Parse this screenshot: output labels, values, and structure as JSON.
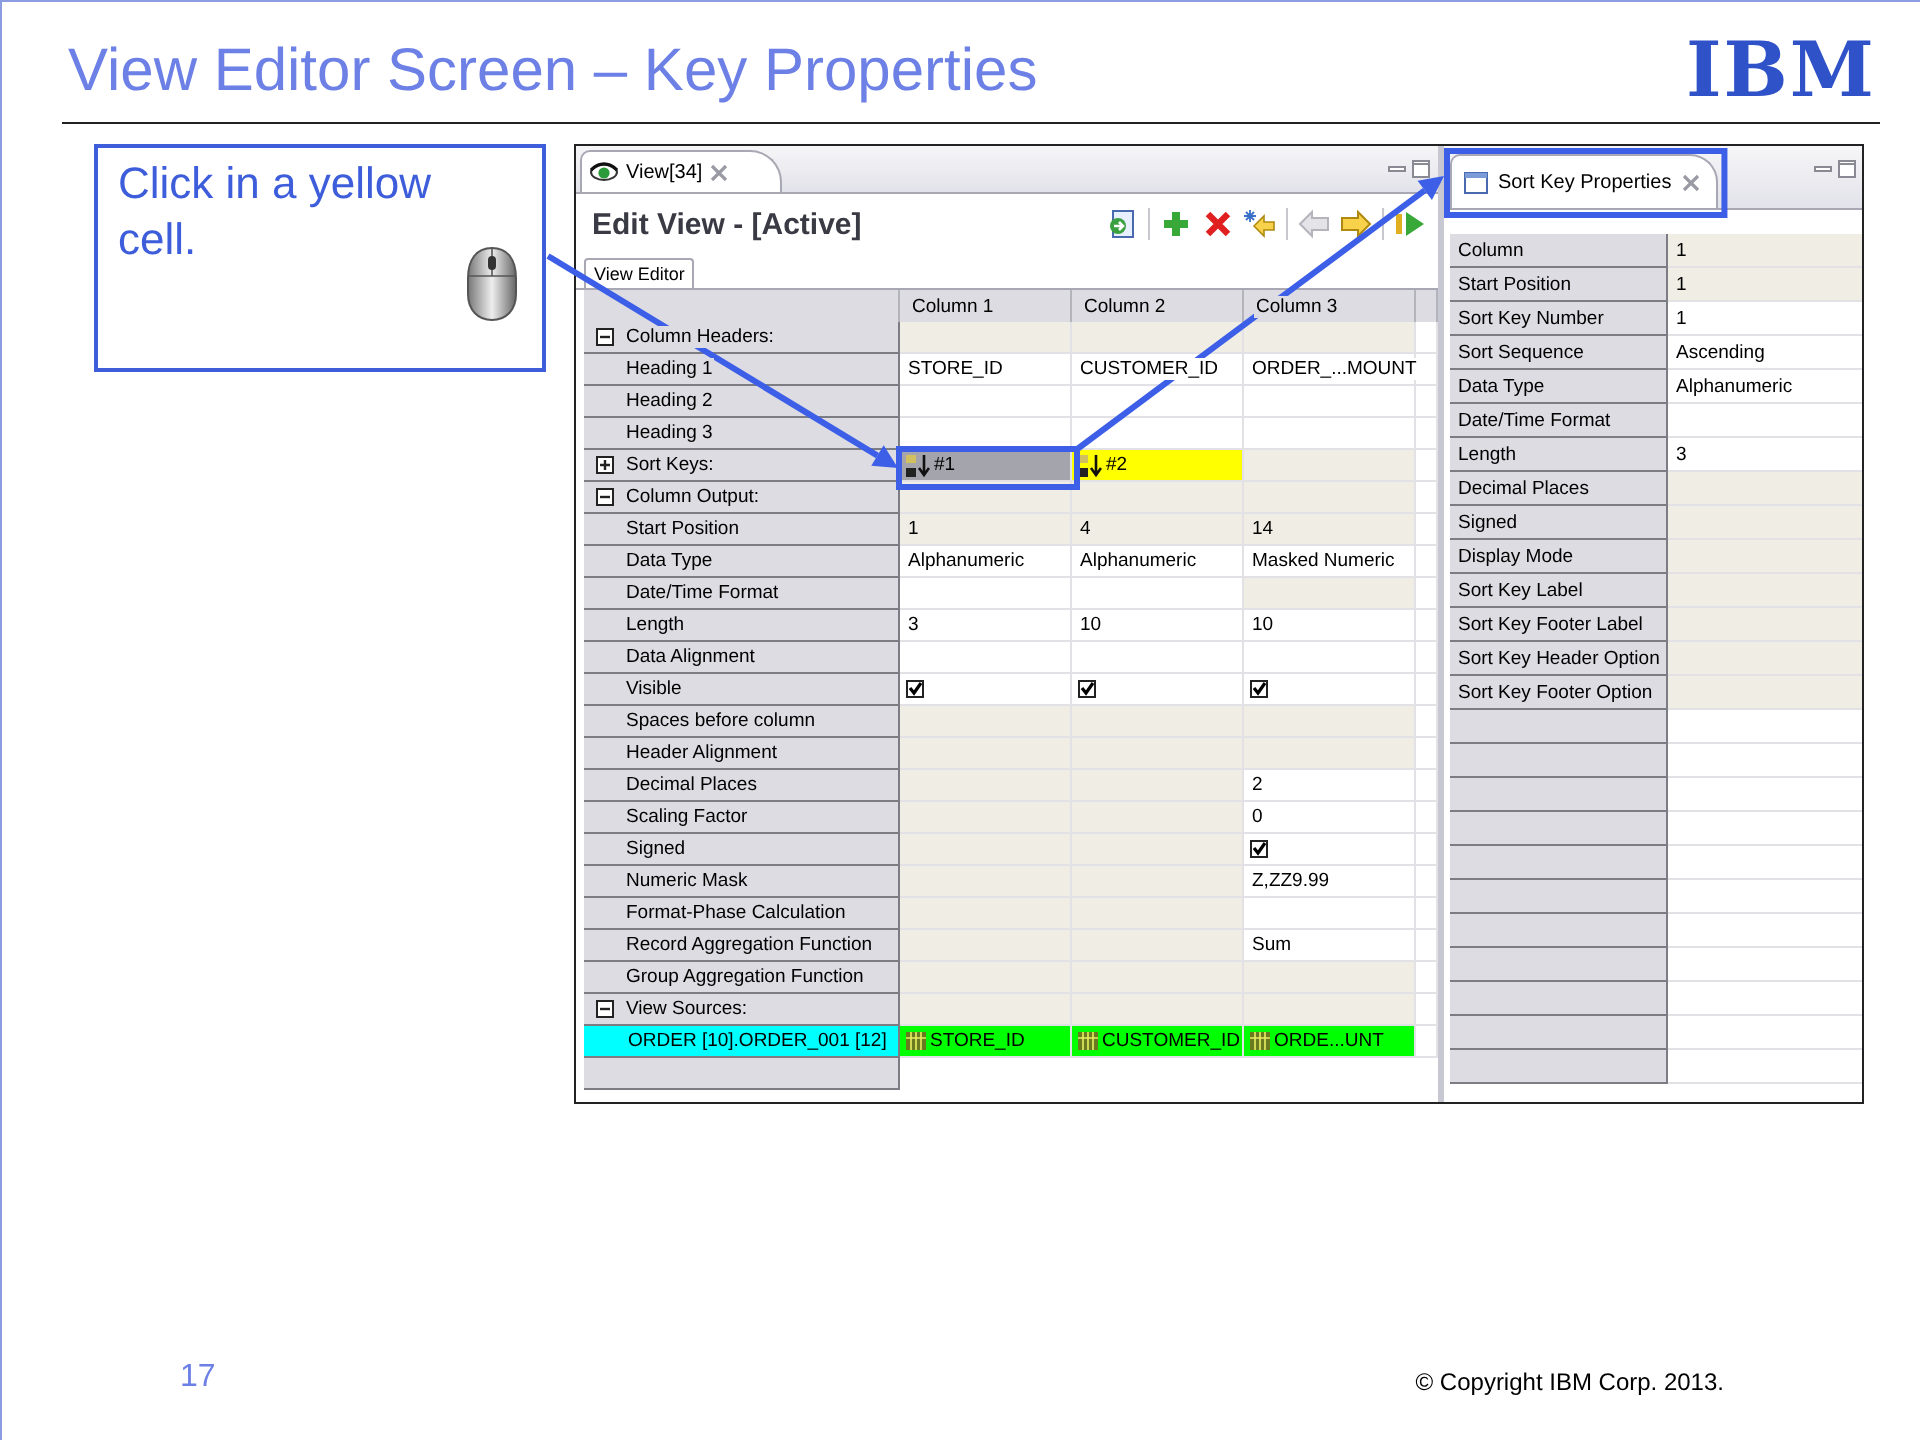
{
  "slide": {
    "title": "View Editor Screen – Key Properties",
    "logo": "IBM",
    "page_number": "17",
    "copyright": "© Copyright IBM Corp. 2013."
  },
  "callout": {
    "text": "Click in a yellow cell."
  },
  "editor": {
    "tab": "View[34]",
    "title": "Edit View - [Active]",
    "subtab": "View Editor",
    "toolbar": [
      {
        "kind": "import",
        "disabled": false
      },
      {
        "kind": "separator"
      },
      {
        "kind": "add",
        "disabled": false
      },
      {
        "kind": "delete",
        "disabled": false
      },
      {
        "kind": "insert",
        "disabled": false
      },
      {
        "kind": "separator"
      },
      {
        "kind": "back",
        "disabled": true
      },
      {
        "kind": "forward",
        "disabled": false
      },
      {
        "kind": "separator"
      },
      {
        "kind": "run",
        "disabled": false
      }
    ],
    "columns": [
      "Column 1",
      "Column 2",
      "Column 3"
    ],
    "rows": [
      {
        "kind": "section",
        "label": "Column Headers:",
        "expanded": true
      },
      {
        "kind": "property",
        "label": "Heading 1",
        "cells": [
          {
            "kind": "text",
            "text": "STORE_ID",
            "editable": true
          },
          {
            "kind": "text",
            "text": "CUSTOMER_ID",
            "editable": true
          },
          {
            "kind": "text",
            "text": "ORDER_...MOUNT",
            "editable": true
          }
        ]
      },
      {
        "kind": "property",
        "label": "Heading 2",
        "cells": [
          {
            "kind": "text",
            "editable": true
          },
          {
            "kind": "text",
            "editable": true
          },
          {
            "kind": "text",
            "editable": true
          }
        ]
      },
      {
        "kind": "property",
        "label": "Heading 3",
        "cells": [
          {
            "kind": "text",
            "editable": true
          },
          {
            "kind": "text",
            "editable": true
          },
          {
            "kind": "text",
            "editable": true
          }
        ]
      },
      {
        "kind": "section",
        "label": "Sort Keys:",
        "expanded": false,
        "cells": [
          {
            "kind": "sortkey",
            "text": "#1",
            "selected": true
          },
          {
            "kind": "sortkey",
            "text": "#2",
            "selected": false
          },
          {
            "kind": "text",
            "editable": false
          }
        ]
      },
      {
        "kind": "section",
        "label": "Column Output:",
        "expanded": true
      },
      {
        "kind": "property",
        "label": "Start Position",
        "cells": [
          {
            "kind": "text",
            "text": "1",
            "editable": false
          },
          {
            "kind": "text",
            "text": "4",
            "editable": false
          },
          {
            "kind": "text",
            "text": "14",
            "editable": false
          }
        ]
      },
      {
        "kind": "property",
        "label": "Data Type",
        "cells": [
          {
            "kind": "text",
            "text": "Alphanumeric",
            "editable": true
          },
          {
            "kind": "text",
            "text": "Alphanumeric",
            "editable": true
          },
          {
            "kind": "text",
            "text": "Masked Numeric",
            "editable": true
          }
        ]
      },
      {
        "kind": "property",
        "label": "Date/Time Format",
        "cells": [
          {
            "kind": "text",
            "editable": true
          },
          {
            "kind": "text",
            "editable": true
          },
          {
            "kind": "text",
            "editable": false
          }
        ]
      },
      {
        "kind": "property",
        "label": "Length",
        "cells": [
          {
            "kind": "text",
            "text": "3",
            "editable": true
          },
          {
            "kind": "text",
            "text": "10",
            "editable": true
          },
          {
            "kind": "text",
            "text": "10",
            "editable": true
          }
        ]
      },
      {
        "kind": "property",
        "label": "Data Alignment",
        "cells": [
          {
            "kind": "text",
            "editable": true
          },
          {
            "kind": "text",
            "editable": true
          },
          {
            "kind": "text",
            "editable": true
          }
        ]
      },
      {
        "kind": "property",
        "label": "Visible",
        "cells": [
          {
            "kind": "checkbox",
            "checked": true,
            "editable": true
          },
          {
            "kind": "checkbox",
            "checked": true,
            "editable": true
          },
          {
            "kind": "checkbox",
            "checked": true,
            "editable": true
          }
        ]
      },
      {
        "kind": "property",
        "label": "Spaces before column",
        "cells": [
          {
            "kind": "text",
            "editable": false
          },
          {
            "kind": "text",
            "editable": false
          },
          {
            "kind": "text",
            "editable": false
          }
        ]
      },
      {
        "kind": "property",
        "label": "Header Alignment",
        "cells": [
          {
            "kind": "text",
            "editable": false
          },
          {
            "kind": "text",
            "editable": false
          },
          {
            "kind": "text",
            "editable": false
          }
        ]
      },
      {
        "kind": "property",
        "label": "Decimal Places",
        "cells": [
          {
            "kind": "text",
            "editable": false
          },
          {
            "kind": "text",
            "editable": false
          },
          {
            "kind": "text",
            "text": "2",
            "editable": true
          }
        ]
      },
      {
        "kind": "property",
        "label": "Scaling Factor",
        "cells": [
          {
            "kind": "text",
            "editable": false
          },
          {
            "kind": "text",
            "editable": false
          },
          {
            "kind": "text",
            "text": "0",
            "editable": true
          }
        ]
      },
      {
        "kind": "property",
        "label": "Signed",
        "cells": [
          {
            "kind": "text",
            "editable": false
          },
          {
            "kind": "text",
            "editable": false
          },
          {
            "kind": "checkbox",
            "checked": true,
            "editable": true
          }
        ]
      },
      {
        "kind": "property",
        "label": "Numeric Mask",
        "cells": [
          {
            "kind": "text",
            "editable": false
          },
          {
            "kind": "text",
            "editable": false
          },
          {
            "kind": "text",
            "text": "Z,ZZ9.99",
            "editable": true
          }
        ]
      },
      {
        "kind": "property",
        "label": "Format-Phase Calculation",
        "cells": [
          {
            "kind": "text",
            "editable": false
          },
          {
            "kind": "text",
            "editable": false
          },
          {
            "kind": "text",
            "editable": true
          }
        ]
      },
      {
        "kind": "property",
        "label": "Record Aggregation Function",
        "cells": [
          {
            "kind": "text",
            "editable": false
          },
          {
            "kind": "text",
            "editable": false
          },
          {
            "kind": "text",
            "text": "Sum",
            "editable": true
          }
        ]
      },
      {
        "kind": "property",
        "label": "Group Aggregation Function",
        "cells": [
          {
            "kind": "text",
            "editable": false
          },
          {
            "kind": "text",
            "editable": false
          },
          {
            "kind": "text",
            "editable": false
          }
        ]
      },
      {
        "kind": "section",
        "label": "View Sources:",
        "expanded": true
      },
      {
        "kind": "source",
        "label": "ORDER [10].ORDER_001 [12]",
        "cells": [
          {
            "kind": "field",
            "text": "STORE_ID"
          },
          {
            "kind": "field",
            "text": "CUSTOMER_ID"
          },
          {
            "kind": "field",
            "text": "ORDE...UNT"
          }
        ]
      }
    ]
  },
  "properties": {
    "tab": "Sort Key Properties",
    "rows": [
      {
        "label": "Column",
        "value": "1",
        "editable": false
      },
      {
        "label": "Start Position",
        "value": "1",
        "editable": false
      },
      {
        "label": "Sort Key Number",
        "value": "1",
        "editable": true
      },
      {
        "label": "Sort Sequence",
        "value": "Ascending",
        "editable": true
      },
      {
        "label": "Data Type",
        "value": "Alphanumeric",
        "editable": true
      },
      {
        "label": "Date/Time Format",
        "editable": true
      },
      {
        "label": "Length",
        "value": "3",
        "editable": true
      },
      {
        "label": "Decimal Places",
        "editable": false
      },
      {
        "label": "Signed",
        "editable": false
      },
      {
        "label": "Display Mode",
        "editable": false
      },
      {
        "label": "Sort Key Label",
        "editable": false
      },
      {
        "label": "Sort Key Footer Label",
        "editable": false
      },
      {
        "label": "Sort Key Header Option",
        "editable": false
      },
      {
        "label": "Sort Key Footer Option",
        "editable": false
      }
    ]
  }
}
